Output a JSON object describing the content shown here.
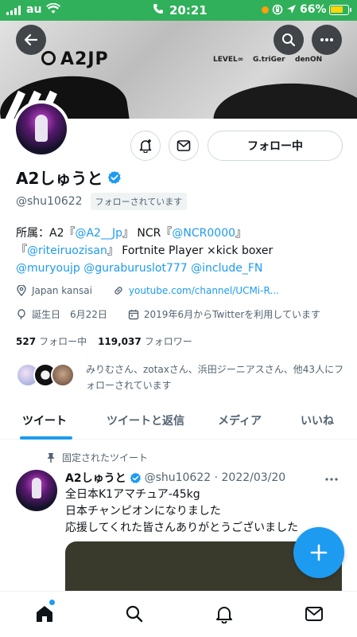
{
  "status_bar": {
    "carrier": "au",
    "time": "20:21",
    "battery": "66%"
  },
  "banner": {
    "logo": "A2JP",
    "sponsors": [
      "LEVEL∞",
      "G.triGer",
      "denON"
    ]
  },
  "profile": {
    "name": "A2しゅうと",
    "handle": "@shu10622",
    "follows_you": "フォローされています",
    "follow_button": "フォロー中",
    "bio": {
      "line1_prefix": "所属：A2『",
      "line1_link1": "@A2__Jp",
      "line1_mid": "』 NCR『",
      "line1_link2": "@NCR0000",
      "line1_suffix": "』",
      "line2_prefix": "『",
      "line2_link": "@riteiruozisan",
      "line2_suffix": "』 Fortnite Player ×kick boxer",
      "line3_link1": "@muryoujp",
      "line3_link2": "@guraburuslot777",
      "line3_link3": "@include_FN"
    },
    "location": "Japan kansai",
    "website": "youtube.com/channel/UCMi-R...",
    "birthday": "誕生日　6月22日",
    "joined": "2019年6月からTwitterを利用しています",
    "following_count": "527",
    "following_label": "フォロー中",
    "followers_count": "119,037",
    "followers_label": "フォロワー",
    "followers_you_know": "みりむさん、zotaxさん、浜田ジーニアスさん、他43人にフォローされています"
  },
  "tabs": [
    {
      "label": "ツイート"
    },
    {
      "label": "ツイートと返信"
    },
    {
      "label": "メディア"
    },
    {
      "label": "いいね"
    }
  ],
  "pinned_tweet": {
    "pinned_label": "固定されたツイート",
    "author": "A2しゅうと",
    "handle_date": "@shu10622 · 2022/03/20",
    "lines": [
      "全日本K1アマチュア-45kg",
      "日本チャンピオンになりました",
      "応援してくれた皆さんありがとうございました"
    ]
  },
  "colors": {
    "accent": "#1d9bf0",
    "status_bar": "#30b05a",
    "text_secondary": "#536471"
  },
  "icons": {
    "nav": [
      "home-icon",
      "search-icon",
      "bell-icon",
      "mail-icon"
    ]
  }
}
